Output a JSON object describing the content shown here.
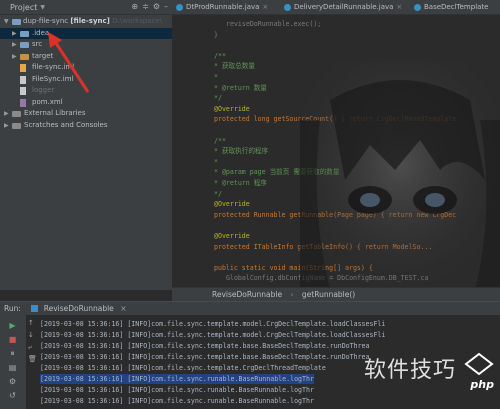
{
  "project": {
    "header_title": "Project",
    "header_icons": [
      "globe-icon",
      "split-icon",
      "gear-icon",
      "minus-icon"
    ],
    "root": {
      "name": "dup-file-sync",
      "module": "[file-sync]",
      "path": "D:\\workspace\\"
    },
    "items": [
      {
        "label": ".idea",
        "type": "folder",
        "color": "blue",
        "arrow": "right",
        "indent": 1,
        "selected": true
      },
      {
        "label": "src",
        "type": "folder",
        "color": "blue",
        "arrow": "right",
        "indent": 1
      },
      {
        "label": "target",
        "type": "folder",
        "color": "orange",
        "arrow": "right",
        "indent": 1
      },
      {
        "label": "file-sync.iml",
        "type": "file",
        "ext": "xml",
        "indent": 1
      },
      {
        "label": "FileSync.iml",
        "type": "file",
        "ext": "iml",
        "indent": 1
      },
      {
        "label": "logger",
        "type": "file",
        "ext": "txt",
        "indent": 1,
        "muted": true
      },
      {
        "label": "pom.xml",
        "type": "file",
        "ext": "m",
        "indent": 1
      },
      {
        "label": "External Libraries",
        "type": "lib",
        "arrow": "right",
        "indent": 0
      },
      {
        "label": "Scratches and Consoles",
        "type": "scratch",
        "arrow": "right",
        "indent": 0
      }
    ]
  },
  "tabs": [
    {
      "label": "DtProdRunnable.java"
    },
    {
      "label": "DeliveryDetailRunnable.java"
    },
    {
      "label": "BaseDeclTemplate"
    }
  ],
  "code": [
    {
      "line": "reviseDoRunnable.exec();",
      "indent": 2,
      "cls": "dim"
    },
    {
      "line": "}",
      "indent": 1,
      "cls": "dim"
    },
    {
      "line": "",
      "indent": 0
    },
    {
      "line": "/**",
      "indent": 1,
      "cls": "cmt"
    },
    {
      "line": " * 获取总数量",
      "indent": 1,
      "cls": "cmt"
    },
    {
      "line": " *",
      "indent": 1,
      "cls": "cmt"
    },
    {
      "line": " * @return 数量",
      "indent": 1,
      "cls": "cmt"
    },
    {
      "line": " */",
      "indent": 1,
      "cls": "cmt"
    },
    {
      "line": "@Override",
      "indent": 1,
      "cls": "ann"
    },
    {
      "line": "protected long getSourceCount() { return CrgDeclMasedTemplate",
      "indent": 1,
      "cls": "mix1"
    },
    {
      "line": "",
      "indent": 0
    },
    {
      "line": "/**",
      "indent": 1,
      "cls": "cmt"
    },
    {
      "line": " * 获取执行的程序",
      "indent": 1,
      "cls": "cmt"
    },
    {
      "line": " *",
      "indent": 1,
      "cls": "cmt"
    },
    {
      "line": " * @param page 当前页 需要获取的数量",
      "indent": 1,
      "cls": "cmt"
    },
    {
      "line": " * @return 程序",
      "indent": 1,
      "cls": "cmt"
    },
    {
      "line": " */",
      "indent": 1,
      "cls": "cmt"
    },
    {
      "line": "@Override",
      "indent": 1,
      "cls": "ann"
    },
    {
      "line": "protected Runnable getRunnable(Page page) { return new CrgDec",
      "indent": 1,
      "cls": "mix2"
    },
    {
      "line": "",
      "indent": 0
    },
    {
      "line": "@Override",
      "indent": 1,
      "cls": "ann"
    },
    {
      "line": "protected ITableInfo getTableInfo() { return ModelSo...",
      "indent": 1,
      "cls": "mix3"
    },
    {
      "line": "",
      "indent": 0
    },
    {
      "line": "public static void main(String[] args) {",
      "indent": 1,
      "cls": "mix4"
    },
    {
      "line": "GlobalConfig.dbConfigName = DbConfigEnum.DB_TEST.ca",
      "indent": 2,
      "cls": "dim"
    }
  ],
  "breadcrumb": {
    "class_name": "ReviseDoRunnable",
    "separator": "›",
    "method": "getRunnable()"
  },
  "run": {
    "label": "Run:",
    "config": "ReviseDoRunnable",
    "close": "×"
  },
  "console_lines": [
    {
      "text": "[2019-03-08 15:36:16] [INFO]com.file.sync.template.model.CrgDeclTemplate.loadClassesFli"
    },
    {
      "text": "[2019-03-08 15:36:16] [INFO]com.file.sync.template.model.CrgDeclTemplate.loadClassesFli"
    },
    {
      "text": "[2019-03-08 15:36:16] [INFO]com.file.sync.template.base.BaseDeclTemplate.runDoThrea"
    },
    {
      "text": "[2019-03-08 15:36:16] [INFO]com.file.sync.template.base.BaseDeclTemplate.runDoThrea"
    },
    {
      "text": "[2019-03-08 15:36:16] [INFO]com.file.sync.template.CrgDeclThreadTemplate"
    },
    {
      "text": "[2019-03-08 15:36:16] [INFO]com.file.sync.runable.BaseRunnable.logThr",
      "selected": true
    },
    {
      "text": "[2019-03-08 15:36:16] [INFO]com.file.sync.runable.BaseRunnable.logThr"
    },
    {
      "text": "[2019-03-08 15:36:16] [INFO]com.file.sync.runable.BaseRunnable.logThr"
    }
  ],
  "watermark": {
    "text": "软件技巧",
    "logo_text": "php"
  },
  "colors": {
    "accent_blue": "#3592c4",
    "selection": "#214283",
    "arrow_red": "#d9322b"
  }
}
